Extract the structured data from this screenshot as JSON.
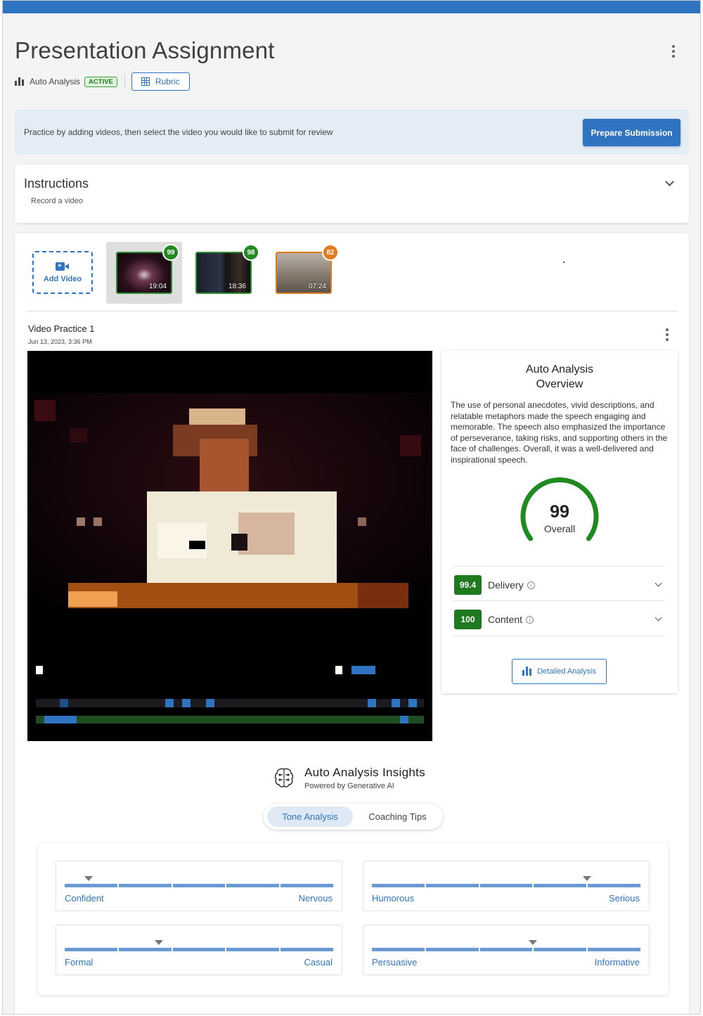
{
  "header": {
    "title": "Presentation Assignment",
    "auto_analysis_label": "Auto Analysis",
    "status_badge": "ACTIVE",
    "rubric_label": "Rubric"
  },
  "banner": {
    "text": "Practice by adding videos, then select the video you would like to submit for review",
    "button": "Prepare Submission"
  },
  "instructions": {
    "title": "Instructions",
    "text": "Record a video"
  },
  "videos": {
    "add_label": "Add Video",
    "items": [
      {
        "score": "99",
        "duration": "19:04",
        "status_color": "#1f8a1f"
      },
      {
        "score": "98",
        "duration": "18:36",
        "status_color": "#1f8a1f"
      },
      {
        "score": "82",
        "duration": "07:24",
        "status_color": "#e07a1f"
      }
    ]
  },
  "practice": {
    "title": "Video Practice 1",
    "date": "Jun 13, 2023, 3:36 PM"
  },
  "overview": {
    "title_line1": "Auto Analysis",
    "title_line2": "Overview",
    "summary": "The use of personal anecdotes, vivid descriptions, and relatable metaphors made the speech engaging and memorable. The speech also emphasized the importance of perseverance, taking risks, and supporting others in the face of challenges. Overall, it was a well-delivered and inspirational speech.",
    "overall_score": "99",
    "overall_label": "Overall",
    "gauge_color": "#1f8a1f",
    "metrics": [
      {
        "score": "99.4",
        "label": "Delivery"
      },
      {
        "score": "100",
        "label": "Content"
      }
    ],
    "detail_button": "Detailed Analysis"
  },
  "insights": {
    "title": "Auto Analysis Insights",
    "subtitle": "Powered by Generative AI",
    "tabs": [
      "Tone Analysis",
      "Coaching Tips"
    ],
    "active_tab": "Tone Analysis"
  },
  "tone": [
    {
      "left": "Confident",
      "right": "Nervous",
      "level": 0.09
    },
    {
      "left": "Humorous",
      "right": "Serious",
      "level": 0.8
    },
    {
      "left": "Formal",
      "right": "Casual",
      "level": 0.35
    },
    {
      "left": "Persuasive",
      "right": "Informative",
      "level": 0.6
    }
  ],
  "colors": {
    "accent": "#2f74c0",
    "success": "#1f8a1f",
    "warning": "#e07a1f"
  }
}
